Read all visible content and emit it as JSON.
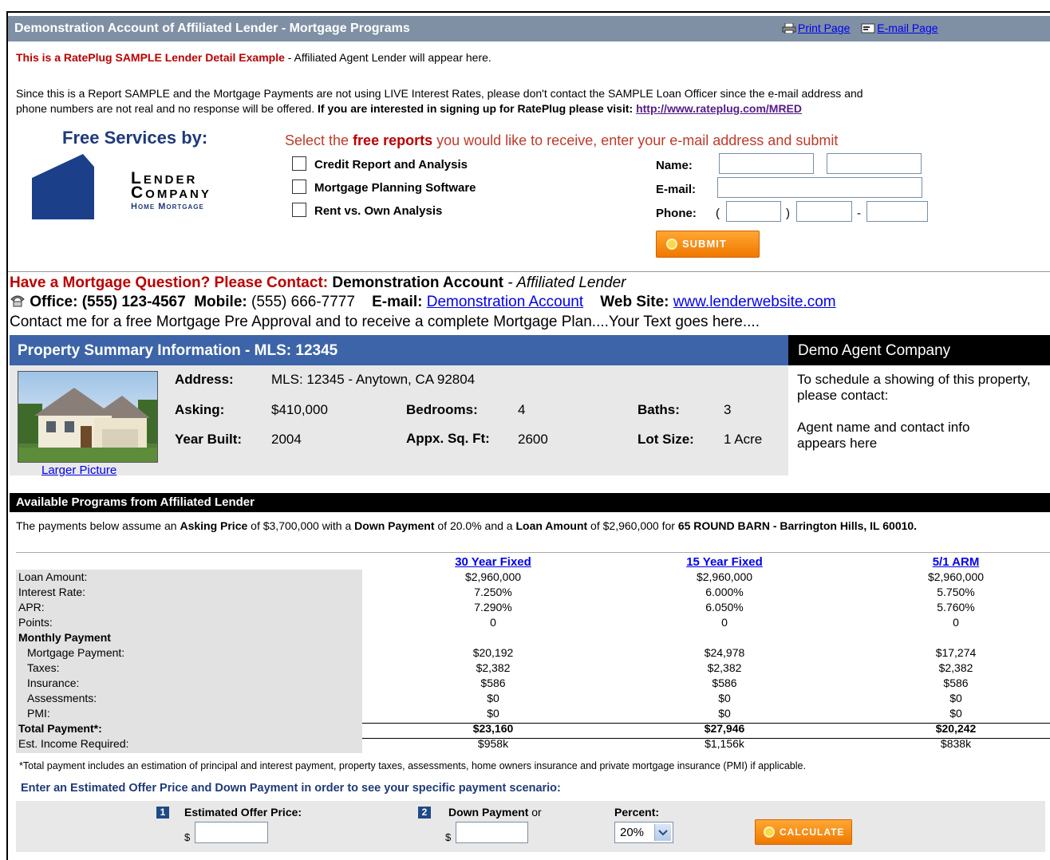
{
  "header": {
    "title": "Demonstration Account of Affiliated Lender - Mortgage Programs",
    "print_label": "Print Page",
    "email_label": "E-mail Page"
  },
  "intro": {
    "sample_label": "This is a RatePlug SAMPLE Lender Detail Example",
    "sample_suffix": " - Affiliated Agent Lender will appear here.",
    "disclaimer_line1": "Since this is a Report SAMPLE and the Mortgage Payments are not using LIVE Interest Rates, please don't contact the SAMPLE Loan Officer since the e-mail address and",
    "disclaimer_line2": "phone numbers are not real and no response will be offered.",
    "signup_text": "If you are interested in signing up for RatePlug please visit:",
    "signup_link": "http://www.rateplug.com/MRED"
  },
  "services": {
    "heading": "Free Services by:",
    "logo_line1": "Lender",
    "logo_line2": "Company",
    "logo_line3": "Home Mortgage",
    "select_prefix": "Select the ",
    "select_bold": "free reports",
    "select_suffix": " you would like to receive, enter your e-mail address and submit",
    "reports": [
      "Credit Report and Analysis",
      "Mortgage Planning Software",
      "Rent vs. Own Analysis"
    ],
    "name_label": "Name:",
    "email_label": "E-mail:",
    "phone_label": "Phone:",
    "phone_open": "(",
    "phone_close": ")",
    "phone_dash": "-",
    "submit_label": "SUBMIT"
  },
  "contact": {
    "question": "Have a Mortgage Question? Please Contact:",
    "name": " Demonstration Account",
    "role": " - Affiliated Lender",
    "office_label": "Office: (555) 123-4567",
    "mobile_label": "Mobile:",
    "mobile_value": "(555) 666-7777",
    "email_label": "E-mail:",
    "email_value": "Demonstration Account",
    "web_label": "Web Site:",
    "web_value": "www.lenderwebsite.com",
    "message": "Contact me for a free Mortgage Pre Approval and to receive a complete Mortgage Plan....Your Text goes here...."
  },
  "property": {
    "title": "Property Summary Information - MLS: 12345",
    "larger_picture": "Larger Picture",
    "address_label": "Address:",
    "address_value": "MLS: 12345 - Anytown, CA 92804",
    "asking_label": "Asking:",
    "asking_value": "$410,000",
    "bedrooms_label": "Bedrooms:",
    "bedrooms_value": "4",
    "baths_label": "Baths:",
    "baths_value": "3",
    "year_label": "Year Built:",
    "year_value": "2004",
    "sqft_label": "Appx. Sq. Ft:",
    "sqft_value": "2600",
    "lot_label": "Lot Size:",
    "lot_value": "1 Acre"
  },
  "agent": {
    "title": "Demo Agent Company",
    "schedule": "To schedule a showing of this property, please contact:",
    "info": "Agent name and contact info appears here"
  },
  "programs": {
    "title": "Available Programs from Affiliated Lender",
    "assume_1": "The payments below assume an ",
    "asking_label": "Asking Price",
    "assume_2": " of $3,700,000 with a ",
    "down_label": "Down Payment",
    "assume_3": " of 20.0% and a ",
    "loan_label": "Loan Amount",
    "assume_4": " of $2,960,000 for ",
    "address": "65 ROUND BARN - Barrington Hills, IL 60010.",
    "columns": [
      "30 Year Fixed",
      "15 Year Fixed",
      "5/1 ARM"
    ],
    "rows": [
      {
        "label": "Loan Amount:",
        "values": [
          "$2,960,000",
          "$2,960,000",
          "$2,960,000"
        ]
      },
      {
        "label": "Interest Rate:",
        "values": [
          "7.250%",
          "6.000%",
          "5.750%"
        ]
      },
      {
        "label": "APR:",
        "values": [
          "7.290%",
          "6.050%",
          "5.760%"
        ]
      },
      {
        "label": "Points:",
        "values": [
          "0",
          "0",
          "0"
        ]
      },
      {
        "label": "Monthly Payment",
        "values": [
          "",
          "",
          ""
        ]
      },
      {
        "label": "Mortgage Payment:",
        "values": [
          "$20,192",
          "$24,978",
          "$17,274"
        ]
      },
      {
        "label": "Taxes:",
        "values": [
          "$2,382",
          "$2,382",
          "$2,382"
        ]
      },
      {
        "label": "Insurance:",
        "values": [
          "$586",
          "$586",
          "$586"
        ]
      },
      {
        "label": "Assessments:",
        "values": [
          "$0",
          "$0",
          "$0"
        ]
      },
      {
        "label": "PMI:",
        "values": [
          "$0",
          "$0",
          "$0"
        ]
      },
      {
        "label": "Total Payment*:",
        "values": [
          "$23,160",
          "$27,946",
          "$20,242"
        ]
      },
      {
        "label": "Est. Income Required:",
        "values": [
          "$958k",
          "$1,156k",
          "$838k"
        ]
      }
    ],
    "footnote": "*Total payment includes an estimation of principal and interest payment, property taxes, assessments, home owners insurance and private mortgage insurance (PMI) if applicable."
  },
  "estimator": {
    "prompt": "Enter an Estimated Offer Price and Down Payment in order to see your specific payment scenario:",
    "step1": "1",
    "offer_label": "Estimated Offer Price:",
    "step2": "2",
    "down_label": "Down Payment",
    "or_label": "or",
    "percent_label": "Percent:",
    "currency": "$",
    "percent_value": "20%",
    "calculate_label": "CALCULATE"
  }
}
